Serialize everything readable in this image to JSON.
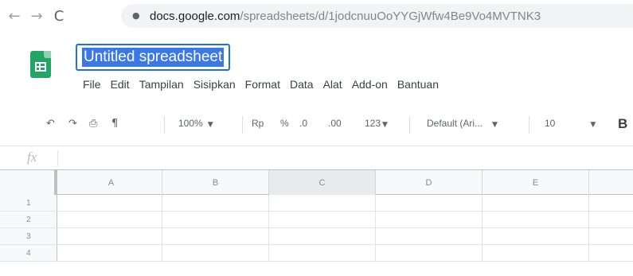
{
  "browser": {
    "url_host": "docs.google.com",
    "url_path": "/spreadsheets/d/1jodcnuuOoYYGjWfw4Be9Vo4MVTNK3"
  },
  "sheets": {
    "title": "Untitled spreadsheet",
    "menu": [
      "File",
      "Edit",
      "Tampilan",
      "Sisipkan",
      "Format",
      "Data",
      "Alat",
      "Add-on",
      "Bantuan"
    ]
  },
  "toolbar": {
    "zoom": "100%",
    "currency": "Rp",
    "percent": "%",
    "decrease_decimal": ".0",
    "increase_decimal": ".00",
    "number_format": "123",
    "font": "Default (Ari...",
    "font_size": "10",
    "bold": "B"
  },
  "formula": {
    "fx": "fx"
  },
  "grid": {
    "columns": [
      "A",
      "B",
      "C",
      "D",
      "E"
    ],
    "rows": [
      "1",
      "2",
      "3",
      "4"
    ]
  }
}
